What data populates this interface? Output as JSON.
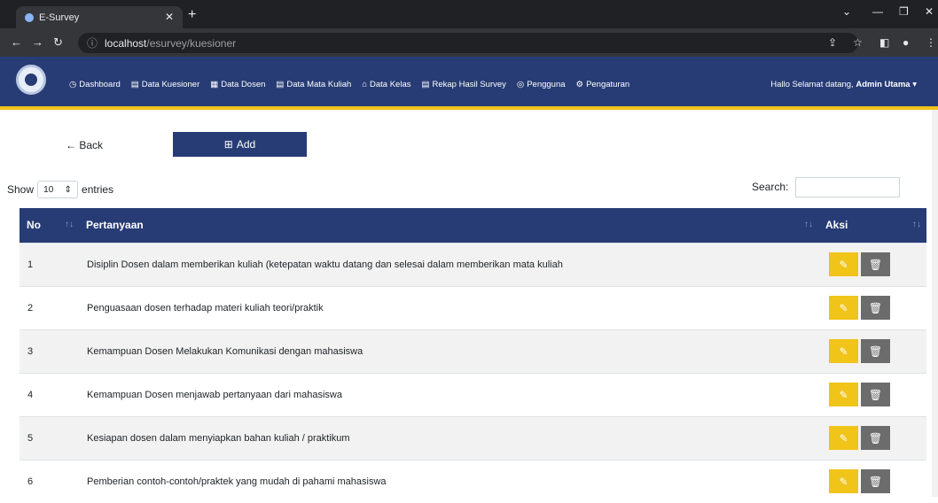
{
  "browser": {
    "tab_title": "E-Survey",
    "url_host": "localhost",
    "url_path": "/esurvey/kuesioner"
  },
  "nav": {
    "items": [
      {
        "icon": "dashboard-icon",
        "glyph": "◷",
        "label": "Dashboard"
      },
      {
        "icon": "list-icon",
        "glyph": "▤",
        "label": "Data Kuesioner"
      },
      {
        "icon": "grid-icon",
        "glyph": "▦",
        "label": "Data Dosen"
      },
      {
        "icon": "list-icon",
        "glyph": "▤",
        "label": "Data Mata Kuliah"
      },
      {
        "icon": "home-icon",
        "glyph": "⌂",
        "label": "Data Kelas"
      },
      {
        "icon": "list-icon",
        "glyph": "▤",
        "label": "Rekap Hasil Survey"
      },
      {
        "icon": "user-icon",
        "glyph": "◎",
        "label": "Pengguna"
      },
      {
        "icon": "gear-icon",
        "glyph": "⚙",
        "label": "Pengaturan"
      }
    ],
    "greeting": "Hallo Selamat datang,",
    "user": "Admin Utama"
  },
  "actions": {
    "back_label": "Back",
    "add_label": "Add"
  },
  "table_controls": {
    "show_label": "Show",
    "entries_value": "10",
    "entries_label": "entries",
    "search_label": "Search:"
  },
  "table": {
    "headers": {
      "no": "No",
      "pertanyaan": "Pertanyaan",
      "aksi": "Aksi"
    },
    "rows": [
      {
        "no": "1",
        "pertanyaan": "Disiplin Dosen dalam memberikan kuliah (ketepatan waktu datang dan selesai dalam memberikan mata kuliah"
      },
      {
        "no": "2",
        "pertanyaan": "Penguasaan dosen terhadap materi kuliah teori/praktik"
      },
      {
        "no": "3",
        "pertanyaan": "Kemampuan Dosen Melakukan Komunikasi dengan mahasiswa"
      },
      {
        "no": "4",
        "pertanyaan": "Kemampuan Dosen menjawab pertanyaan dari mahasiswa"
      },
      {
        "no": "5",
        "pertanyaan": "Kesiapan dosen dalam menyiapkan bahan kuliah / praktikum"
      },
      {
        "no": "6",
        "pertanyaan": "Pemberian contoh-contoh/praktek yang mudah di pahami mahasiswa"
      }
    ]
  },
  "colors": {
    "primary": "#273c75",
    "accent": "#f0c419",
    "delete": "#6c6c6c"
  }
}
